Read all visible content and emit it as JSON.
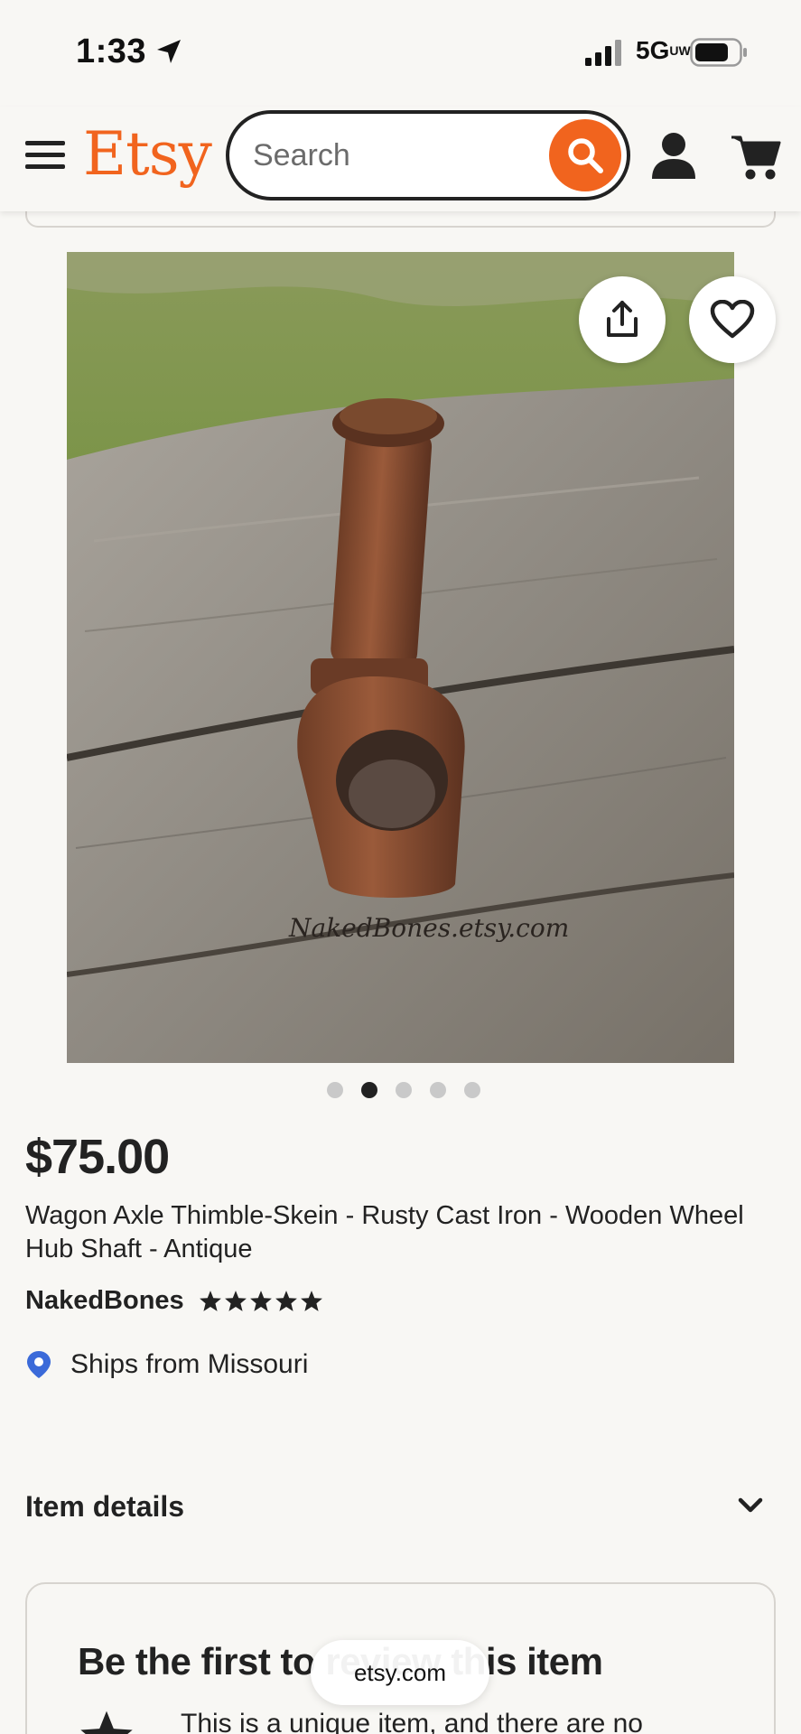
{
  "status_bar": {
    "time": "1:33",
    "network": "5G",
    "network_sup": "UW"
  },
  "header": {
    "logo": "Etsy",
    "search_placeholder": "Search",
    "brand_color": "#f1641e"
  },
  "product": {
    "watermark": "NakedBones.etsy.com",
    "image_count": 5,
    "active_image": 2,
    "price": "$75.00",
    "title": "Wagon Axle Thimble-Skein - Rusty Cast Iron - Wooden Wheel Hub Shaft - Antique",
    "shop_name": "NakedBones",
    "rating": 5,
    "ships_from": "Ships from Missouri"
  },
  "sections": {
    "item_details": "Item details"
  },
  "review_card": {
    "title": "Be the first to review this item",
    "text": "This is a unique item, and there are no"
  },
  "browser": {
    "url": "etsy.com"
  }
}
